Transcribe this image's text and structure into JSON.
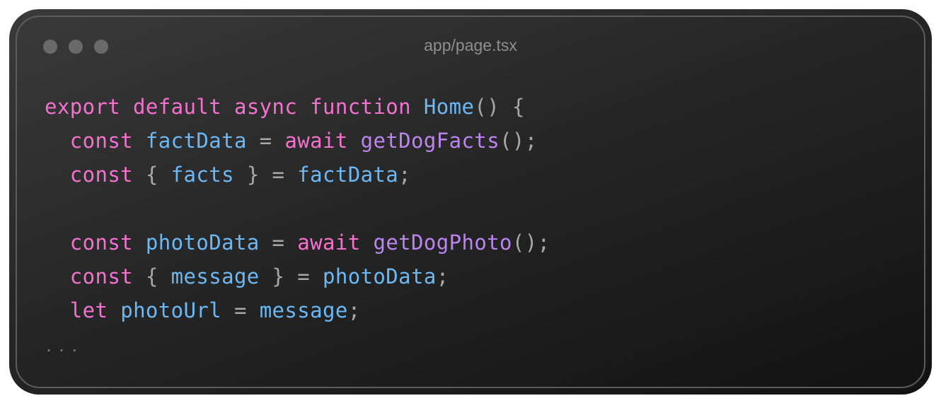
{
  "window": {
    "title": "app/page.tsx",
    "controls": [
      "close",
      "minimize",
      "maximize"
    ]
  },
  "colors": {
    "keyword": "#f471d0",
    "identifier": "#6cb8f5",
    "function_call": "#bc84f0",
    "punctuation": "#a8a8a8"
  },
  "code": {
    "lines": [
      [
        {
          "t": "kw",
          "v": "export"
        },
        {
          "t": "p",
          "v": " "
        },
        {
          "t": "kw",
          "v": "default"
        },
        {
          "t": "p",
          "v": " "
        },
        {
          "t": "kw",
          "v": "async"
        },
        {
          "t": "p",
          "v": " "
        },
        {
          "t": "kw",
          "v": "function"
        },
        {
          "t": "p",
          "v": " "
        },
        {
          "t": "id",
          "v": "Home"
        },
        {
          "t": "p",
          "v": "() {"
        }
      ],
      [
        {
          "t": "p",
          "v": "  "
        },
        {
          "t": "kw",
          "v": "const"
        },
        {
          "t": "p",
          "v": " "
        },
        {
          "t": "id",
          "v": "factData"
        },
        {
          "t": "p",
          "v": " = "
        },
        {
          "t": "kw",
          "v": "await"
        },
        {
          "t": "p",
          "v": " "
        },
        {
          "t": "fn",
          "v": "getDogFacts"
        },
        {
          "t": "p",
          "v": "();"
        }
      ],
      [
        {
          "t": "p",
          "v": "  "
        },
        {
          "t": "kw",
          "v": "const"
        },
        {
          "t": "p",
          "v": " { "
        },
        {
          "t": "id",
          "v": "facts"
        },
        {
          "t": "p",
          "v": " } = "
        },
        {
          "t": "id",
          "v": "factData"
        },
        {
          "t": "p",
          "v": ";"
        }
      ],
      [],
      [
        {
          "t": "p",
          "v": "  "
        },
        {
          "t": "kw",
          "v": "const"
        },
        {
          "t": "p",
          "v": " "
        },
        {
          "t": "id",
          "v": "photoData"
        },
        {
          "t": "p",
          "v": " = "
        },
        {
          "t": "kw",
          "v": "await"
        },
        {
          "t": "p",
          "v": " "
        },
        {
          "t": "fn",
          "v": "getDogPhoto"
        },
        {
          "t": "p",
          "v": "();"
        }
      ],
      [
        {
          "t": "p",
          "v": "  "
        },
        {
          "t": "kw",
          "v": "const"
        },
        {
          "t": "p",
          "v": " { "
        },
        {
          "t": "id",
          "v": "message"
        },
        {
          "t": "p",
          "v": " } = "
        },
        {
          "t": "id",
          "v": "photoData"
        },
        {
          "t": "p",
          "v": ";"
        }
      ],
      [
        {
          "t": "p",
          "v": "  "
        },
        {
          "t": "kw",
          "v": "let"
        },
        {
          "t": "p",
          "v": " "
        },
        {
          "t": "id",
          "v": "photoUrl"
        },
        {
          "t": "p",
          "v": " = "
        },
        {
          "t": "id",
          "v": "message"
        },
        {
          "t": "p",
          "v": ";"
        }
      ],
      [
        {
          "t": "ell",
          "v": "..."
        }
      ]
    ]
  }
}
